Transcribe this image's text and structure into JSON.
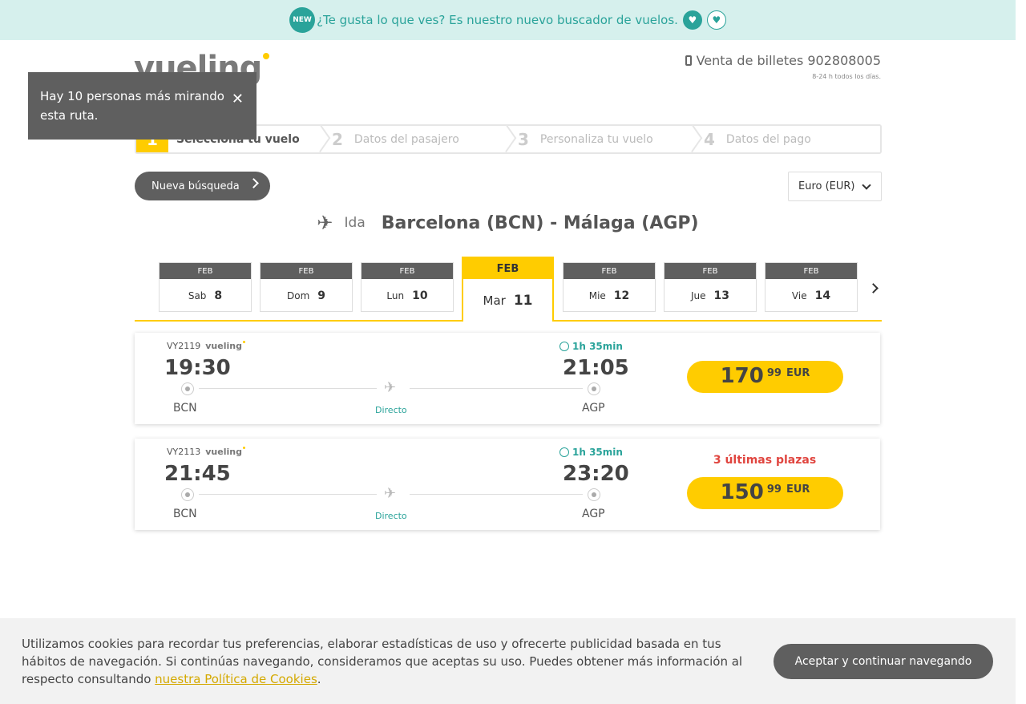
{
  "promo": {
    "badge": "NEW",
    "text": "¿Te gusta lo que ves? Es nuestro nuevo buscador de vuelos.",
    "like_icon": "heart-icon",
    "dislike_icon": "broken-heart-icon"
  },
  "header": {
    "logo": "vueling",
    "phone_label": "Venta de billetes 902808005",
    "phone_hours": "8-24 h todos los días."
  },
  "toast": {
    "text": "Hay 10 personas más mirando esta ruta.",
    "close_glyph": "✕"
  },
  "stepper": {
    "steps": [
      {
        "num": "1",
        "label": "Selecciona tu vuelo"
      },
      {
        "num": "2",
        "label": "Datos del pasajero"
      },
      {
        "num": "3",
        "label": "Personaliza tu vuelo"
      },
      {
        "num": "4",
        "label": "Datos del pago"
      }
    ]
  },
  "toolbar": {
    "new_search": "Nueva búsqueda",
    "currency": "Euro (EUR)"
  },
  "route": {
    "direction": "Ida",
    "title": "Barcelona (BCN) - Málaga (AGP)"
  },
  "dates": [
    {
      "month": "FEB",
      "weekday": "Sab",
      "day": "8"
    },
    {
      "month": "FEB",
      "weekday": "Dom",
      "day": "9"
    },
    {
      "month": "FEB",
      "weekday": "Lun",
      "day": "10"
    },
    {
      "month": "FEB",
      "weekday": "Mar",
      "day": "11"
    },
    {
      "month": "FEB",
      "weekday": "Mie",
      "day": "12"
    },
    {
      "month": "FEB",
      "weekday": "Jue",
      "day": "13"
    },
    {
      "month": "FEB",
      "weekday": "Vie",
      "day": "14"
    }
  ],
  "flights": [
    {
      "number": "VY2119",
      "carrier": "vueling",
      "duration": "1h 35min",
      "departure": "19:30",
      "arrival": "21:05",
      "from": "BCN",
      "to": "AGP",
      "type": "Directo",
      "seats": "",
      "price_int": "170",
      "price_dec": "99",
      "currency": "EUR"
    },
    {
      "number": "VY2113",
      "carrier": "vueling",
      "duration": "1h 35min",
      "departure": "21:45",
      "arrival": "23:20",
      "from": "BCN",
      "to": "AGP",
      "type": "Directo",
      "seats": "3 últimas plazas",
      "price_int": "150",
      "price_dec": "99",
      "currency": "EUR"
    }
  ],
  "cookie": {
    "text_before": "Utilizamos cookies para recordar tus preferencias, elaborar estadísticas de uso y ofrecerte publicidad basada en tus hábitos de navegación. Si continúas navegando, consideramos que aceptas su uso. Puedes obtener más información al respecto consultando ",
    "link": "nuestra Política de Cookies",
    "text_after": ".",
    "accept": "Aceptar y continuar navegando"
  },
  "colors": {
    "brand_yellow": "#ffcc00",
    "teal": "#2aa39a",
    "dark_grey": "#5f5f5f",
    "alert_red": "#e0453f"
  }
}
